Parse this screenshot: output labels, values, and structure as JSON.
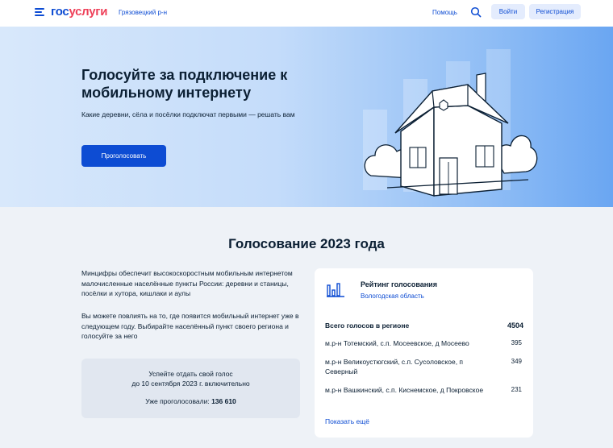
{
  "header": {
    "logo_part1": "гос",
    "logo_part2": "услуги",
    "region": "Грязовецкий р-н",
    "help": "Помощь",
    "login": "Войти",
    "register": "Регистрация"
  },
  "hero": {
    "title": "Голосуйте за подключение к мобильному интернету",
    "subtitle": "Какие деревни, сёла и посёлки подключат первыми — решать вам",
    "vote_button": "Проголосовать"
  },
  "main": {
    "section_title": "Голосование 2023 года",
    "paragraph1": "Минцифры обеспечит высокоскоростным мобильным интернетом малочисленные населённые пункты России: деревни и станицы, посёлки и хутора, кишлаки и аулы",
    "paragraph2": "Вы можете повлиять на то, где появится мобильный интернет уже в следующем году. Выбирайте населённый пункт своего региона и голосуйте за него",
    "deadline_line1": "Успейте отдать свой голос",
    "deadline_line2": "до 10 сентября 2023 г. включительно",
    "voted_label": "Уже проголосовали:",
    "voted_count": "136 610"
  },
  "rating": {
    "title": "Рейтинг голосования",
    "region": "Вологодская область",
    "total_label": "Всего голосов в регионе",
    "total_value": "4504",
    "rows": [
      {
        "name": "м.р-н Тотемский, с.п. Мосеевское, д Мосеево",
        "votes": "395"
      },
      {
        "name": "м.р-н Великоустюгский, с.п. Сусоловское, п Северный",
        "votes": "349"
      },
      {
        "name": "м.р-н Вашкинский, с.п. Киснемское, д Покровское",
        "votes": "231"
      }
    ],
    "show_more": "Показать ещё"
  },
  "colors": {
    "brand_blue": "#0d4cd3",
    "brand_red": "#ee3f58",
    "page_bg": "#eef2f7"
  },
  "icons": [
    "menu-icon",
    "search-icon",
    "bar-chart-icon",
    "house-illustration"
  ]
}
